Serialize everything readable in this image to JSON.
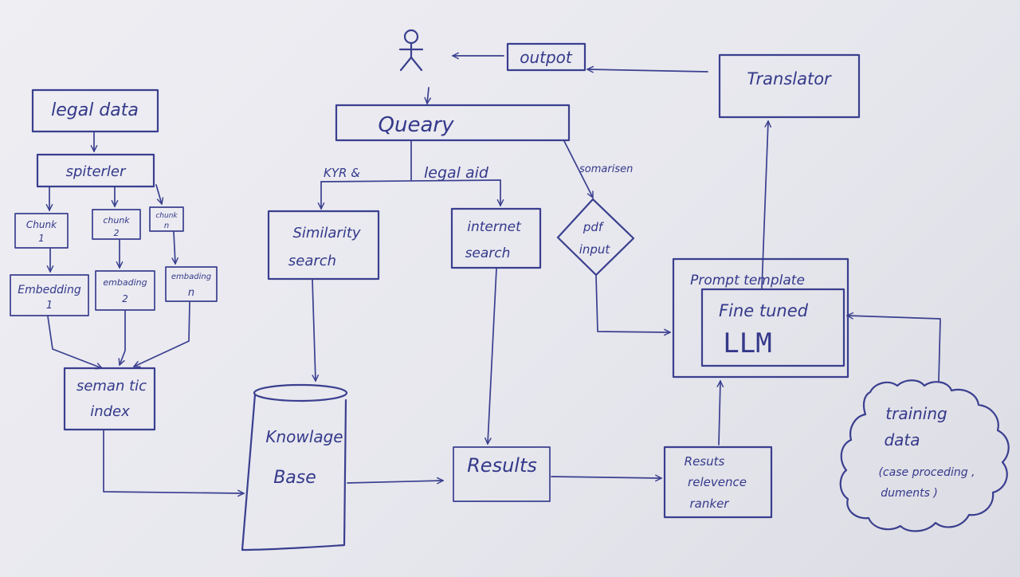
{
  "diagram": {
    "nodes": {
      "user": "",
      "output": "outpot",
      "translator": "Translator",
      "query": "Queary",
      "legal_data": "legal data",
      "splitter": "spiterler",
      "chunk_1": [
        "Chunk",
        "1"
      ],
      "chunk_2": [
        "chunk",
        "2"
      ],
      "chunk_n": [
        "chunk",
        "n"
      ],
      "embedding_1": [
        "Embedding",
        "1"
      ],
      "embedding_2": [
        "embading",
        "2"
      ],
      "embedding_n": [
        "embading",
        "n"
      ],
      "semantic_index": [
        "seman tic",
        "index"
      ],
      "similarity_search": [
        "Similarity",
        "search"
      ],
      "internet_search": [
        "internet",
        "search"
      ],
      "pdf_input": [
        "pdf",
        "input"
      ],
      "knowledge_base": [
        "Knowlage",
        "Base"
      ],
      "results": "Results",
      "relevance_ranker": [
        "Resuts",
        "relevence",
        "ranker"
      ],
      "prompt_template": "Prompt template",
      "fine_tuned_llm": [
        "Fine tuned",
        "LLM"
      ],
      "training_data": [
        "training",
        "data",
        "(case proceding ,",
        "duments )"
      ]
    },
    "edge_labels": {
      "kyr": "KYR  &",
      "legal_aid": "legal aid",
      "summariser": "somarisen"
    }
  },
  "colors": {
    "ink": "#3a3f8f",
    "paper": "#ececf1"
  }
}
